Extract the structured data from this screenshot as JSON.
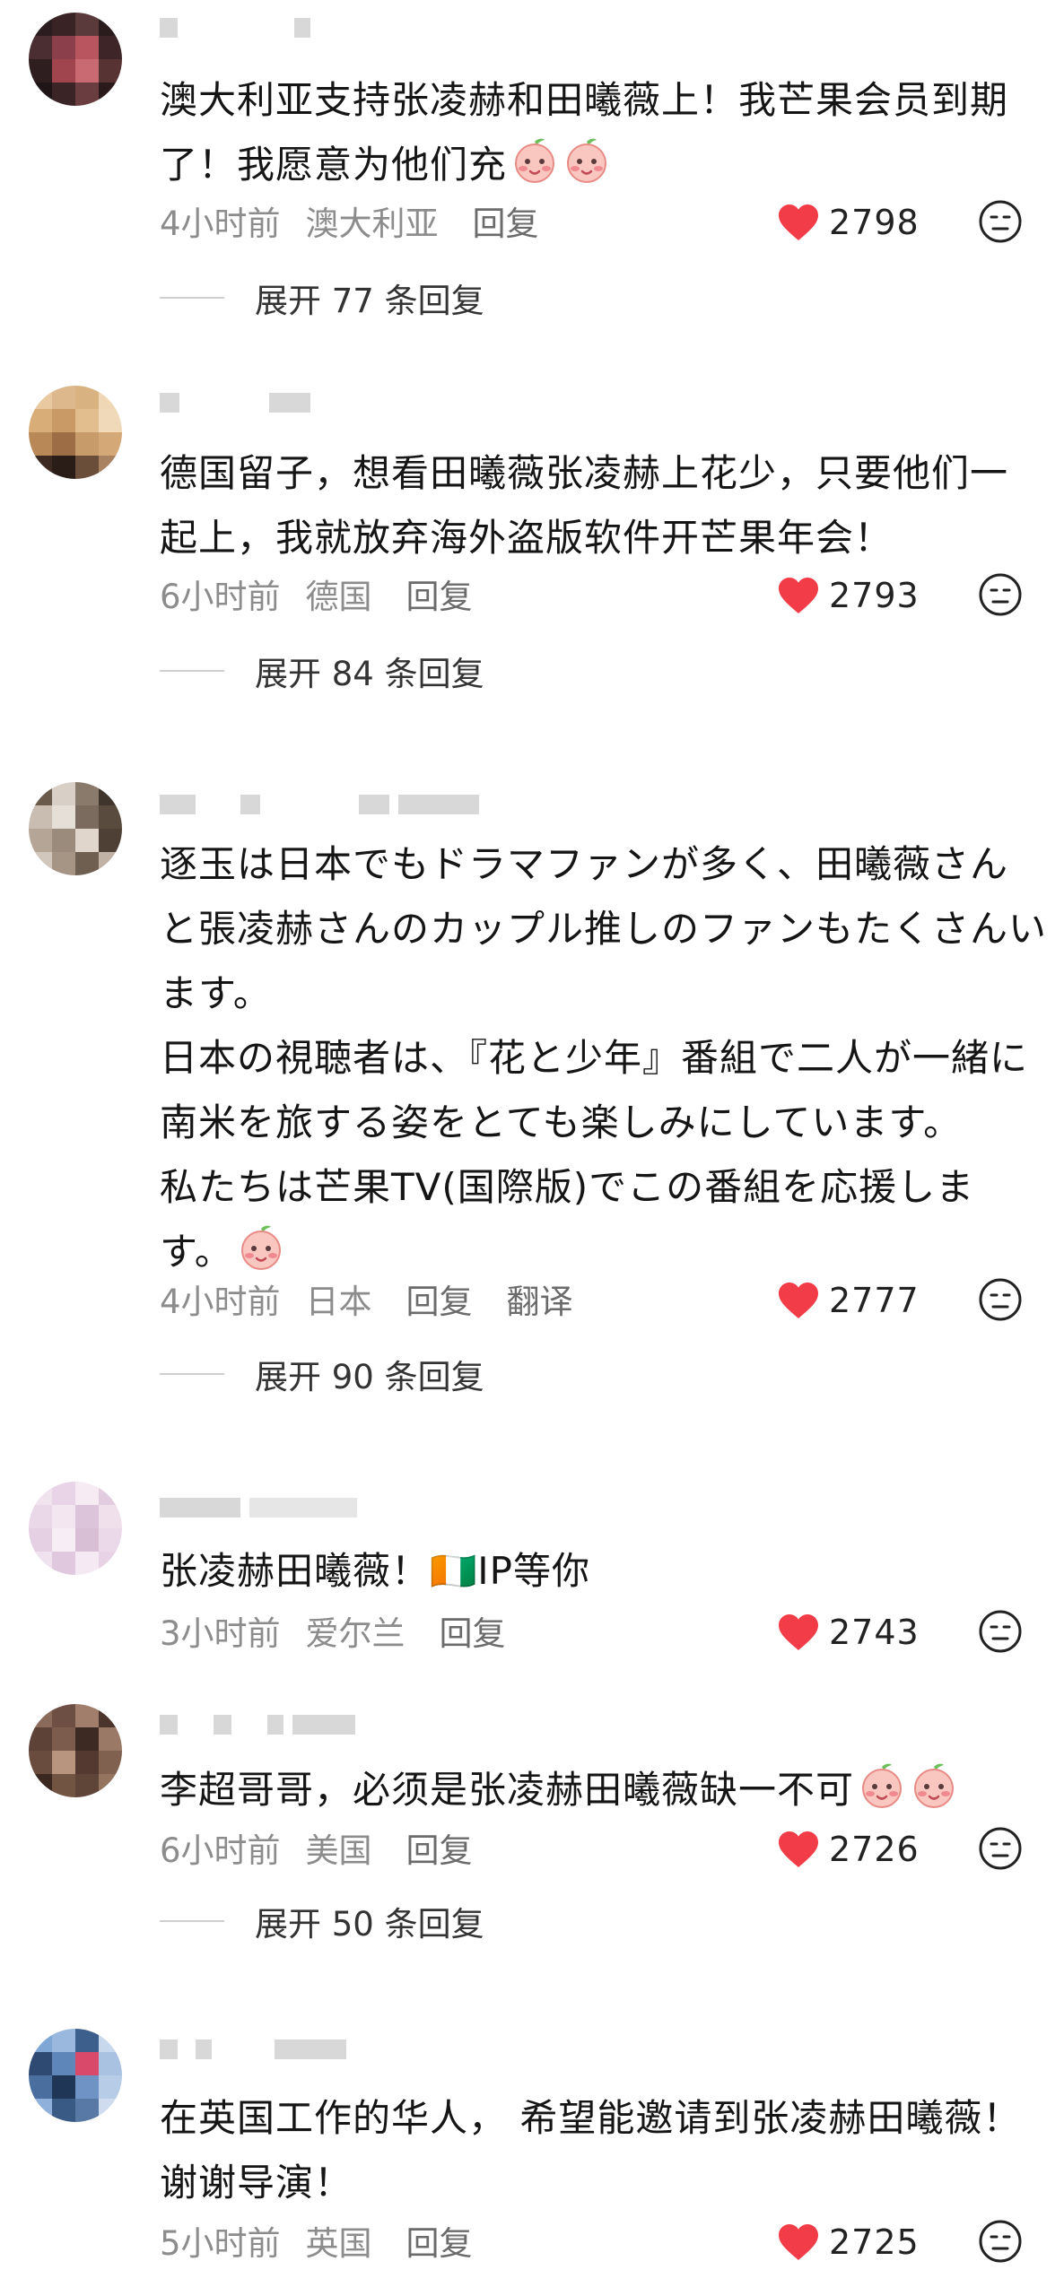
{
  "comments": [
    {
      "lines": [
        "澳大利亚支持张凌赫和田曦薇上！我芒果会员到期",
        "了！我愿意为他们充"
      ],
      "time": "4小时前",
      "location": "澳大利亚",
      "reply": "回复",
      "translate": "",
      "likes": "2798",
      "expand": "展开 77 条回复",
      "avatar_colors": [
        "#2b1d1f",
        "#3a2325",
        "#5a3a3a",
        "#2a1b1d",
        "#4a2e31",
        "#8a3f4a",
        "#b8555f",
        "#3d2528",
        "#2e1e20",
        "#a0444e",
        "#c96a72",
        "#573334",
        "#1f1516",
        "#3b2426",
        "#6a3e40",
        "#2a1a1c"
      ]
    },
    {
      "lines": [
        "德国留子，想看田曦薇张凌赫上花少，只要他们一",
        "起上，我就放弃海外盗版软件开芒果年会！"
      ],
      "time": "6小时前",
      "location": "德国",
      "reply": "回复",
      "translate": "",
      "likes": "2793",
      "expand": "展开 84 条回复",
      "avatar_colors": [
        "#e8c9a0",
        "#dcb88c",
        "#d9b282",
        "#efd6b4",
        "#d8ad78",
        "#c99a66",
        "#e2bd8e",
        "#f0d9b8",
        "#b88957",
        "#9d6e45",
        "#c89b6b",
        "#d5a878",
        "#3c2a22",
        "#2a1d18",
        "#6b4e3a",
        "#a98262"
      ]
    },
    {
      "lines": [
        "逐玉は日本でもドラマファンが多く、田曦薇さん",
        "と張凌赫さんのカップル推しのファンもたくさんい",
        "ます。",
        "日本の視聴者は、『花と少年』番組で二人が一緒に",
        "南米を旅する姿をとても楽しみにしています。",
        "私たちは芒果TV(国際版)でこの番組を応援しま",
        "す。"
      ],
      "time": "4小时前",
      "location": "日本",
      "reply": "回复",
      "translate": "翻译",
      "likes": "2777",
      "expand": "展开 90 条回复",
      "avatar_colors": [
        "#6a5a4c",
        "#d8cfc6",
        "#8a7a6c",
        "#3f352c",
        "#c9bcb0",
        "#e6dfd8",
        "#7a6b5e",
        "#5a4b3f",
        "#b5a597",
        "#9b8b7c",
        "#e0d6cc",
        "#4e4035",
        "#d2c7bc",
        "#a69585",
        "#6e5f51",
        "#c0b2a4"
      ]
    },
    {
      "lines": [
        "张凌赫田曦薇！🇨🇮IP等你"
      ],
      "time": "3小时前",
      "location": "爱尔兰",
      "reply": "回复",
      "translate": "",
      "likes": "2743",
      "expand": "",
      "avatar_colors": [
        "#f1e3ee",
        "#e8d4e6",
        "#f6eaf3",
        "#e2cce0",
        "#ead7e8",
        "#f3e6f1",
        "#dcc4da",
        "#efe0ec",
        "#e5d0e3",
        "#f7edf5",
        "#d9bfd6",
        "#ebd9e9",
        "#f0e2ee",
        "#e0c9de",
        "#f5e9f3",
        "#e7d3e5"
      ]
    },
    {
      "lines": [
        "李超哥哥，必须是张凌赫田曦薇缺一不可"
      ],
      "time": "6小时前",
      "location": "美国",
      "reply": "回复",
      "translate": "",
      "likes": "2726",
      "expand": "展开 50 条回复",
      "avatar_colors": [
        "#8a6a5a",
        "#6d5043",
        "#a07e6b",
        "#4a342b",
        "#5c4237",
        "#7b5c4d",
        "#3d2a23",
        "#9a7a66",
        "#6a4c3f",
        "#b8957f",
        "#53392f",
        "#80604f",
        "#3a2720",
        "#725443",
        "#5f4538",
        "#94745f"
      ]
    },
    {
      "lines": [
        "在英国工作的华人， 希望能邀请到张凌赫田曦薇！",
        "谢谢导演！"
      ],
      "time": "5小时前",
      "location": "英国",
      "reply": "回复",
      "translate": "",
      "likes": "2725",
      "expand": "",
      "avatar_colors": [
        "#7fa7d6",
        "#9ab8de",
        "#3c5f8c",
        "#c8d8ec",
        "#2e4a73",
        "#5e86b8",
        "#d94a6a",
        "#a9c2e2",
        "#4a6e9e",
        "#1f3656",
        "#6f93c4",
        "#b7cce6",
        "#8fb0da",
        "#3a5a86",
        "#5878a6",
        "#cfdcef"
      ]
    }
  ],
  "colors": {
    "heart": "#f23c48",
    "meta": "#8c8c8c",
    "text": "#151515"
  },
  "icons": {
    "like": "heart-icon",
    "dislike": "dislike-face-icon",
    "emoji": "peach-emoji-icon"
  }
}
